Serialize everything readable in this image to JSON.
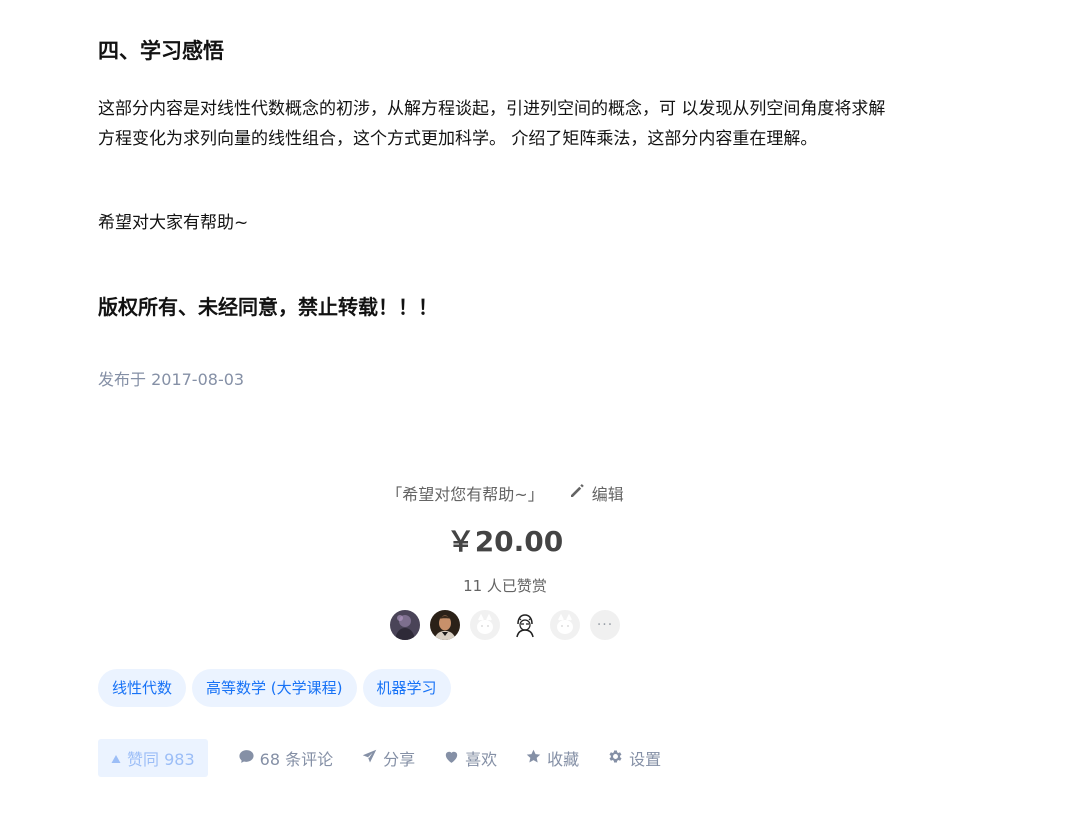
{
  "article": {
    "section_heading": "四、学习感悟",
    "paragraphs": [
      "这部分内容是对线性代数概念的初涉，从解方程谈起，引进列空间的概念，可 以发现从列空间角度将求解方程变化为求列向量的线性组合，这个方式更加科学。 介绍了矩阵乘法，这部分内容重在理解。",
      "希望对大家有帮助~"
    ],
    "copyright": "版权所有、未经同意，禁止转载！！！",
    "publish_time": "发布于 2017-08-03"
  },
  "reward": {
    "message": "「希望对您有帮助~」",
    "edit_label": "编辑",
    "price": "￥20.00",
    "supporters": "11 人已赞赏",
    "more_icon": "more-dots-icon",
    "more_text": "···"
  },
  "tags": [
    "线性代数",
    "高等数学 (大学课程)",
    "机器学习"
  ],
  "actions": {
    "vote_label": "赞同 983",
    "comments_label": "68 条评论",
    "share_label": "分享",
    "like_label": "喜欢",
    "collect_label": "收藏",
    "settings_label": "设置"
  },
  "colors": {
    "accent": "#1772f6",
    "tag_bg": "#ebf3ff",
    "muted": "#8590a6"
  }
}
